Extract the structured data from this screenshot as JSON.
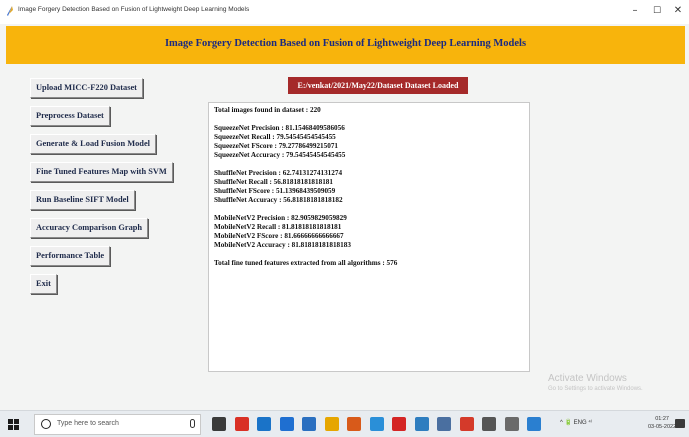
{
  "window": {
    "title": "Image Forgery Detection Based on Fusion of Lightweight Deep Learning Models",
    "minimize": "–",
    "maximize": "☐",
    "close": "✕"
  },
  "banner": {
    "title": "Image Forgery Detection Based on Fusion of Lightweight Deep Learning Models",
    "background": "#f8b40c"
  },
  "sidebar": {
    "buttons": [
      {
        "label": "Upload MICC-F220 Dataset"
      },
      {
        "label": "Preprocess Dataset"
      },
      {
        "label": "Generate & Load Fusion Model"
      },
      {
        "label": "Fine Tuned Features Map with SVM"
      },
      {
        "label": "Run Baseline SIFT Model"
      },
      {
        "label": "Accuracy Comparison Graph"
      },
      {
        "label": "Performance Table"
      },
      {
        "label": "Exit"
      }
    ]
  },
  "status": {
    "text": "E:/venkat/2021/May22/Dataset Dataset Loaded",
    "background": "#a52a2a"
  },
  "output": {
    "lines": [
      "Total images found in dataset : 220",
      "SqueezeNet Precision : 81.15468409586056",
      "SqueezeNet Recall   : 79.54545454545455",
      "SqueezeNet FScore   : 79.27786499215071",
      "SqueezeNet Accuracy : 79.54545454545455",
      "ShuffleNet Precision : 62.74131274131274",
      "ShuffleNet Recall   : 56.81818181818181",
      "ShuffleNet FScore   : 51.13968439509059",
      "ShuffleNet Accuracy : 56.81818181818182",
      "MobileNetV2 Precision : 82.9059829059829",
      "MobileNetV2 Recall   : 81.81818181818181",
      "MobileNetV2 FScore   : 81.66666666666667",
      "MobileNetV2 Accuracy : 81.81818181818183",
      "Total fine tuned features extracted from all algorithms : 576"
    ]
  },
  "watermark": {
    "title": "Activate Windows",
    "subtitle": "Go to Settings to activate Windows."
  },
  "taskbar": {
    "search_placeholder": "Type here to search",
    "tray": "^ 🔋 ENG ⁴⁾",
    "time": "01:27",
    "date": "03-05-2022",
    "apps": [
      {
        "icon": "task-view-icon",
        "color": "#3a3a3a"
      },
      {
        "icon": "chrome-icon",
        "color": "#d93025"
      },
      {
        "icon": "edge-icon",
        "color": "#1a73c8"
      },
      {
        "icon": "file-explorer-icon",
        "color": "#1f6fd1"
      },
      {
        "icon": "store-icon",
        "color": "#2a6fc0"
      },
      {
        "icon": "office-icon",
        "color": "#e6a600"
      },
      {
        "icon": "firefox-icon",
        "color": "#d85a1a"
      },
      {
        "icon": "paint-icon",
        "color": "#2a8fd8"
      },
      {
        "icon": "acrobat-icon",
        "color": "#d42525"
      },
      {
        "icon": "python-icon",
        "color": "#2e7dbf"
      },
      {
        "icon": "notepad-icon",
        "color": "#4a6fa0"
      },
      {
        "icon": "media-icon",
        "color": "#d43a2a"
      },
      {
        "icon": "ide-icon",
        "color": "#555555"
      },
      {
        "icon": "settings-icon",
        "color": "#6a6a6a"
      },
      {
        "icon": "app-icon",
        "color": "#2a7fd0"
      }
    ]
  }
}
